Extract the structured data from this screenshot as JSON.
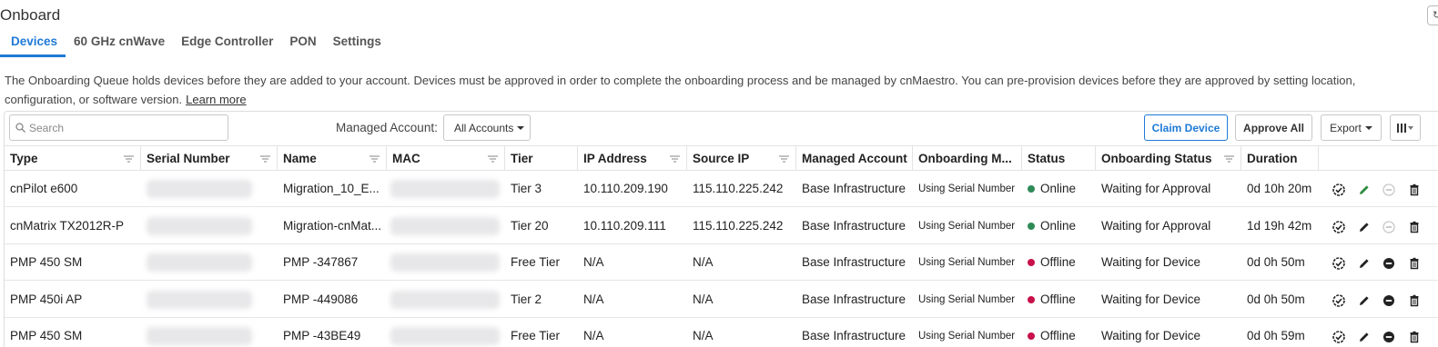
{
  "page": {
    "title": "Onboard"
  },
  "tabs": [
    {
      "label": "Devices",
      "active": true
    },
    {
      "label": "60 GHz cnWave"
    },
    {
      "label": "Edge Controller"
    },
    {
      "label": "PON"
    },
    {
      "label": "Settings"
    }
  ],
  "description": {
    "text": "The Onboarding Queue holds devices before they are added to your account. Devices must be approved in order to complete the onboarding process and be managed by cnMaestro. You can pre-provision devices before they are approved by setting location, configuration, or software version.",
    "learn_more": "Learn more"
  },
  "toolbar": {
    "search_placeholder": "Search",
    "managed_account_label": "Managed Account:",
    "managed_account_value": "All Accounts",
    "claim_device": "Claim Device",
    "approve_all": "Approve All",
    "export": "Export",
    "columns_icon": "columns-icon"
  },
  "columns": [
    "Type",
    "Serial Number",
    "Name",
    "MAC",
    "Tier",
    "IP Address",
    "Source IP",
    "Managed Account",
    "Onboarding M...",
    "Status",
    "Onboarding Status",
    "Duration"
  ],
  "rows": [
    {
      "type": "cnPilot e600",
      "name": "Migration_10_E...",
      "tier": "Tier 3",
      "ip": "10.110.209.190",
      "source_ip": "115.110.225.242",
      "account": "Base Infrastructure",
      "method": "Using Serial Number",
      "status": "Online",
      "onboarding_status": "Waiting for Approval",
      "duration": "0d 10h 20m",
      "edit_color": "green",
      "toggle": "disabled"
    },
    {
      "type": "cnMatrix TX2012R-P",
      "name": "Migration-cnMat...",
      "tier": "Tier 20",
      "ip": "10.110.209.111",
      "source_ip": "115.110.225.242",
      "account": "Base Infrastructure",
      "method": "Using Serial Number",
      "status": "Online",
      "onboarding_status": "Waiting for Approval",
      "duration": "1d 19h 42m",
      "edit_color": "black",
      "toggle": "disabled"
    },
    {
      "type": "PMP 450 SM",
      "name": "PMP -347867",
      "tier": "Free Tier",
      "ip": "N/A",
      "source_ip": "N/A",
      "account": "Base Infrastructure",
      "method": "Using Serial Number",
      "status": "Offline",
      "onboarding_status": "Waiting for Device",
      "duration": "0d 0h 50m",
      "edit_color": "black",
      "toggle": "enabled"
    },
    {
      "type": "PMP 450i AP",
      "name": "PMP -449086",
      "tier": "Tier 2",
      "ip": "N/A",
      "source_ip": "N/A",
      "account": "Base Infrastructure",
      "method": "Using Serial Number",
      "status": "Offline",
      "onboarding_status": "Waiting for Device",
      "duration": "0d 0h 50m",
      "edit_color": "black",
      "toggle": "enabled"
    },
    {
      "type": "PMP 450 SM",
      "name": "PMP -43BE49",
      "tier": "Free Tier",
      "ip": "N/A",
      "source_ip": "N/A",
      "account": "Base Infrastructure",
      "method": "Using Serial Number",
      "status": "Offline",
      "onboarding_status": "Waiting for Device",
      "duration": "0d 0h 59m",
      "edit_color": "black",
      "toggle": "enabled"
    }
  ],
  "colors": {
    "accent": "#1f7ad6",
    "online": "#2e8b57",
    "offline": "#c8104a",
    "edit_green": "#2e8b3e"
  }
}
